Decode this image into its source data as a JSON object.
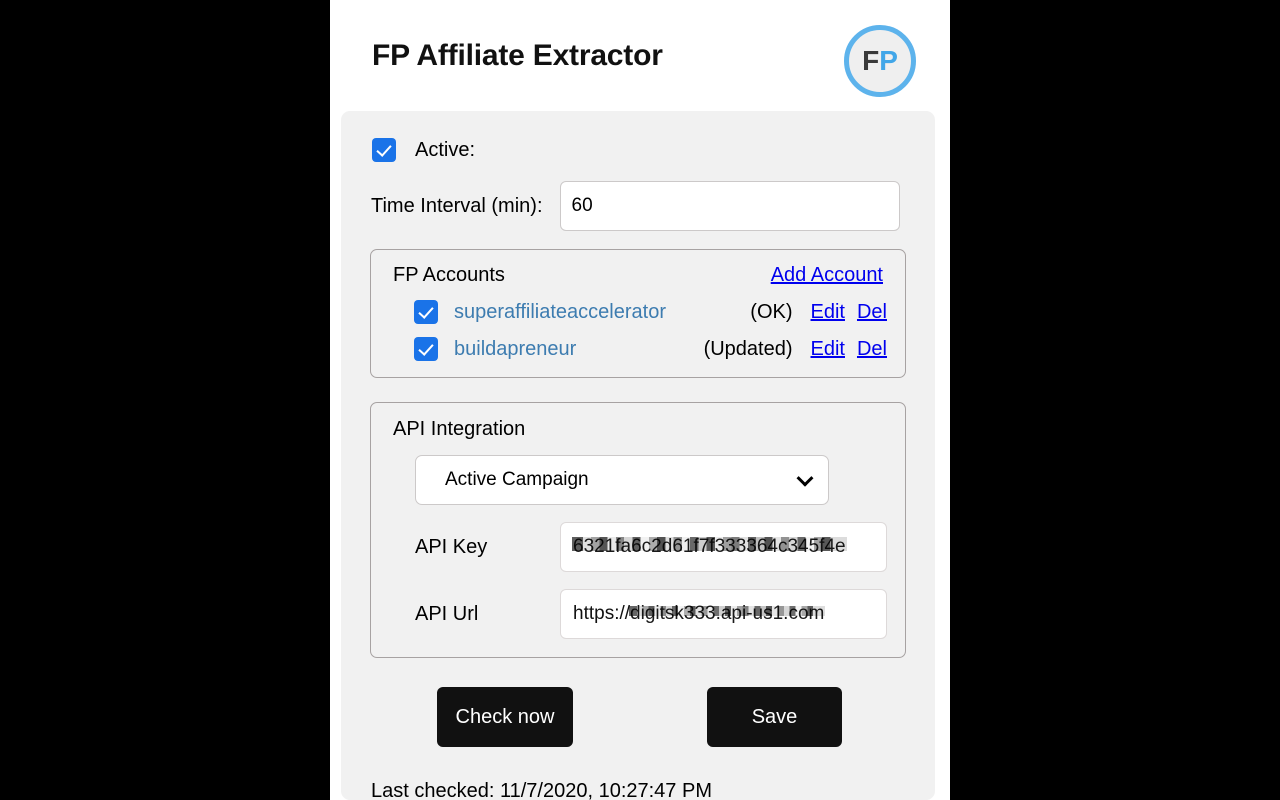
{
  "header": {
    "title": "FP Affiliate Extractor",
    "logo": {
      "left": "F",
      "right": "P"
    }
  },
  "settings": {
    "active_label": "Active:",
    "active_checked": true,
    "interval_label": "Time Interval (min):",
    "interval_value": "60",
    "interval_placeholder": "60"
  },
  "accounts": {
    "title": "FP Accounts",
    "add_label": "Add Account",
    "edit_label": "Edit",
    "del_label": "Del",
    "items": [
      {
        "name": "superaffiliateaccelerator",
        "status": "(OK)",
        "checked": true
      },
      {
        "name": "buildapreneur",
        "status": "(Updated)",
        "checked": true
      }
    ]
  },
  "api": {
    "title": "API Integration",
    "provider_selected": "Active Campaign",
    "provider_options": [
      "Active Campaign"
    ],
    "key_label": "API Key",
    "key_value": "6321fa6c2d61f7f333364c345f4e",
    "url_label": "API Url",
    "url_prefix": "https://",
    "url_redacted": "digitsk333.api-us1.com"
  },
  "actions": {
    "check_now_label": "Check now",
    "save_label": "Save"
  },
  "footer": {
    "last_checked": "Last checked: 11/7/2020, 10:27:47 PM"
  },
  "colors": {
    "accent_blue": "#1a73e8",
    "link_blue": "#0000ee",
    "account_blue": "#3d7cb0",
    "logo_ring": "#5db3ec",
    "button_dark": "#111111",
    "panel_gray": "#f1f1f1"
  }
}
